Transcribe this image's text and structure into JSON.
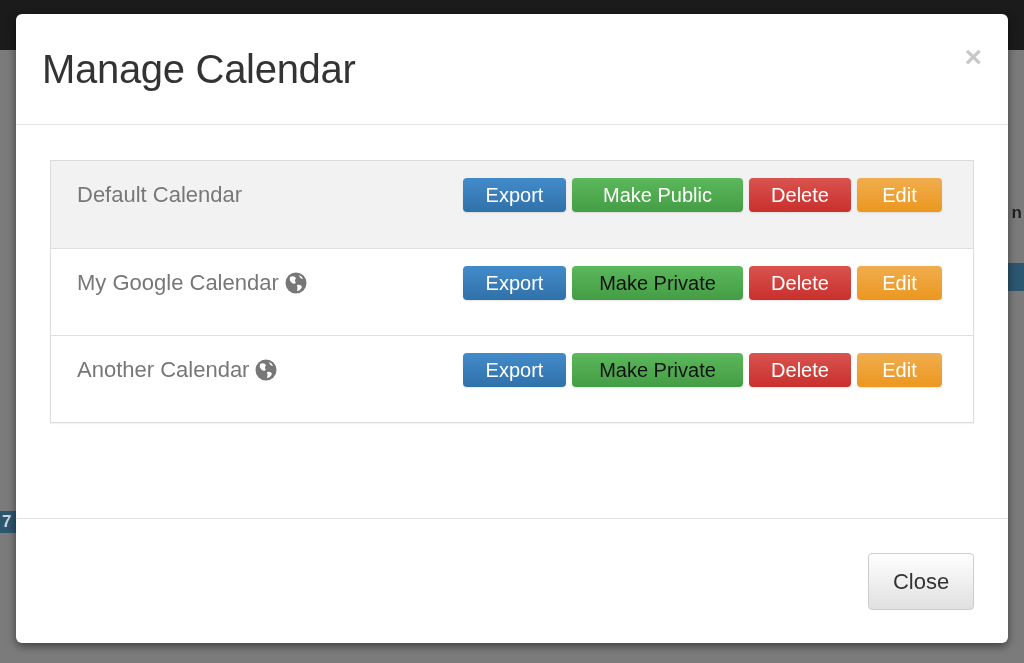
{
  "background": {
    "fragments": [
      {
        "text": "n",
        "kind": "heading"
      },
      {
        "text": "7",
        "kind": "event"
      }
    ]
  },
  "modal": {
    "title": "Manage Calendar",
    "close_icon": "×",
    "calendars": [
      {
        "name": "Default Calendar",
        "public": false,
        "highlighted": true,
        "buttons": [
          "Export",
          "Make Public",
          "Delete",
          "Edit"
        ]
      },
      {
        "name": "My Google Calendar",
        "public": true,
        "highlighted": false,
        "buttons": [
          "Export",
          "Make Private",
          "Delete",
          "Edit"
        ]
      },
      {
        "name": "Another Calendar",
        "public": true,
        "highlighted": false,
        "buttons": [
          "Export",
          "Make Private",
          "Delete",
          "Edit"
        ]
      }
    ],
    "footer_button": "Close"
  }
}
